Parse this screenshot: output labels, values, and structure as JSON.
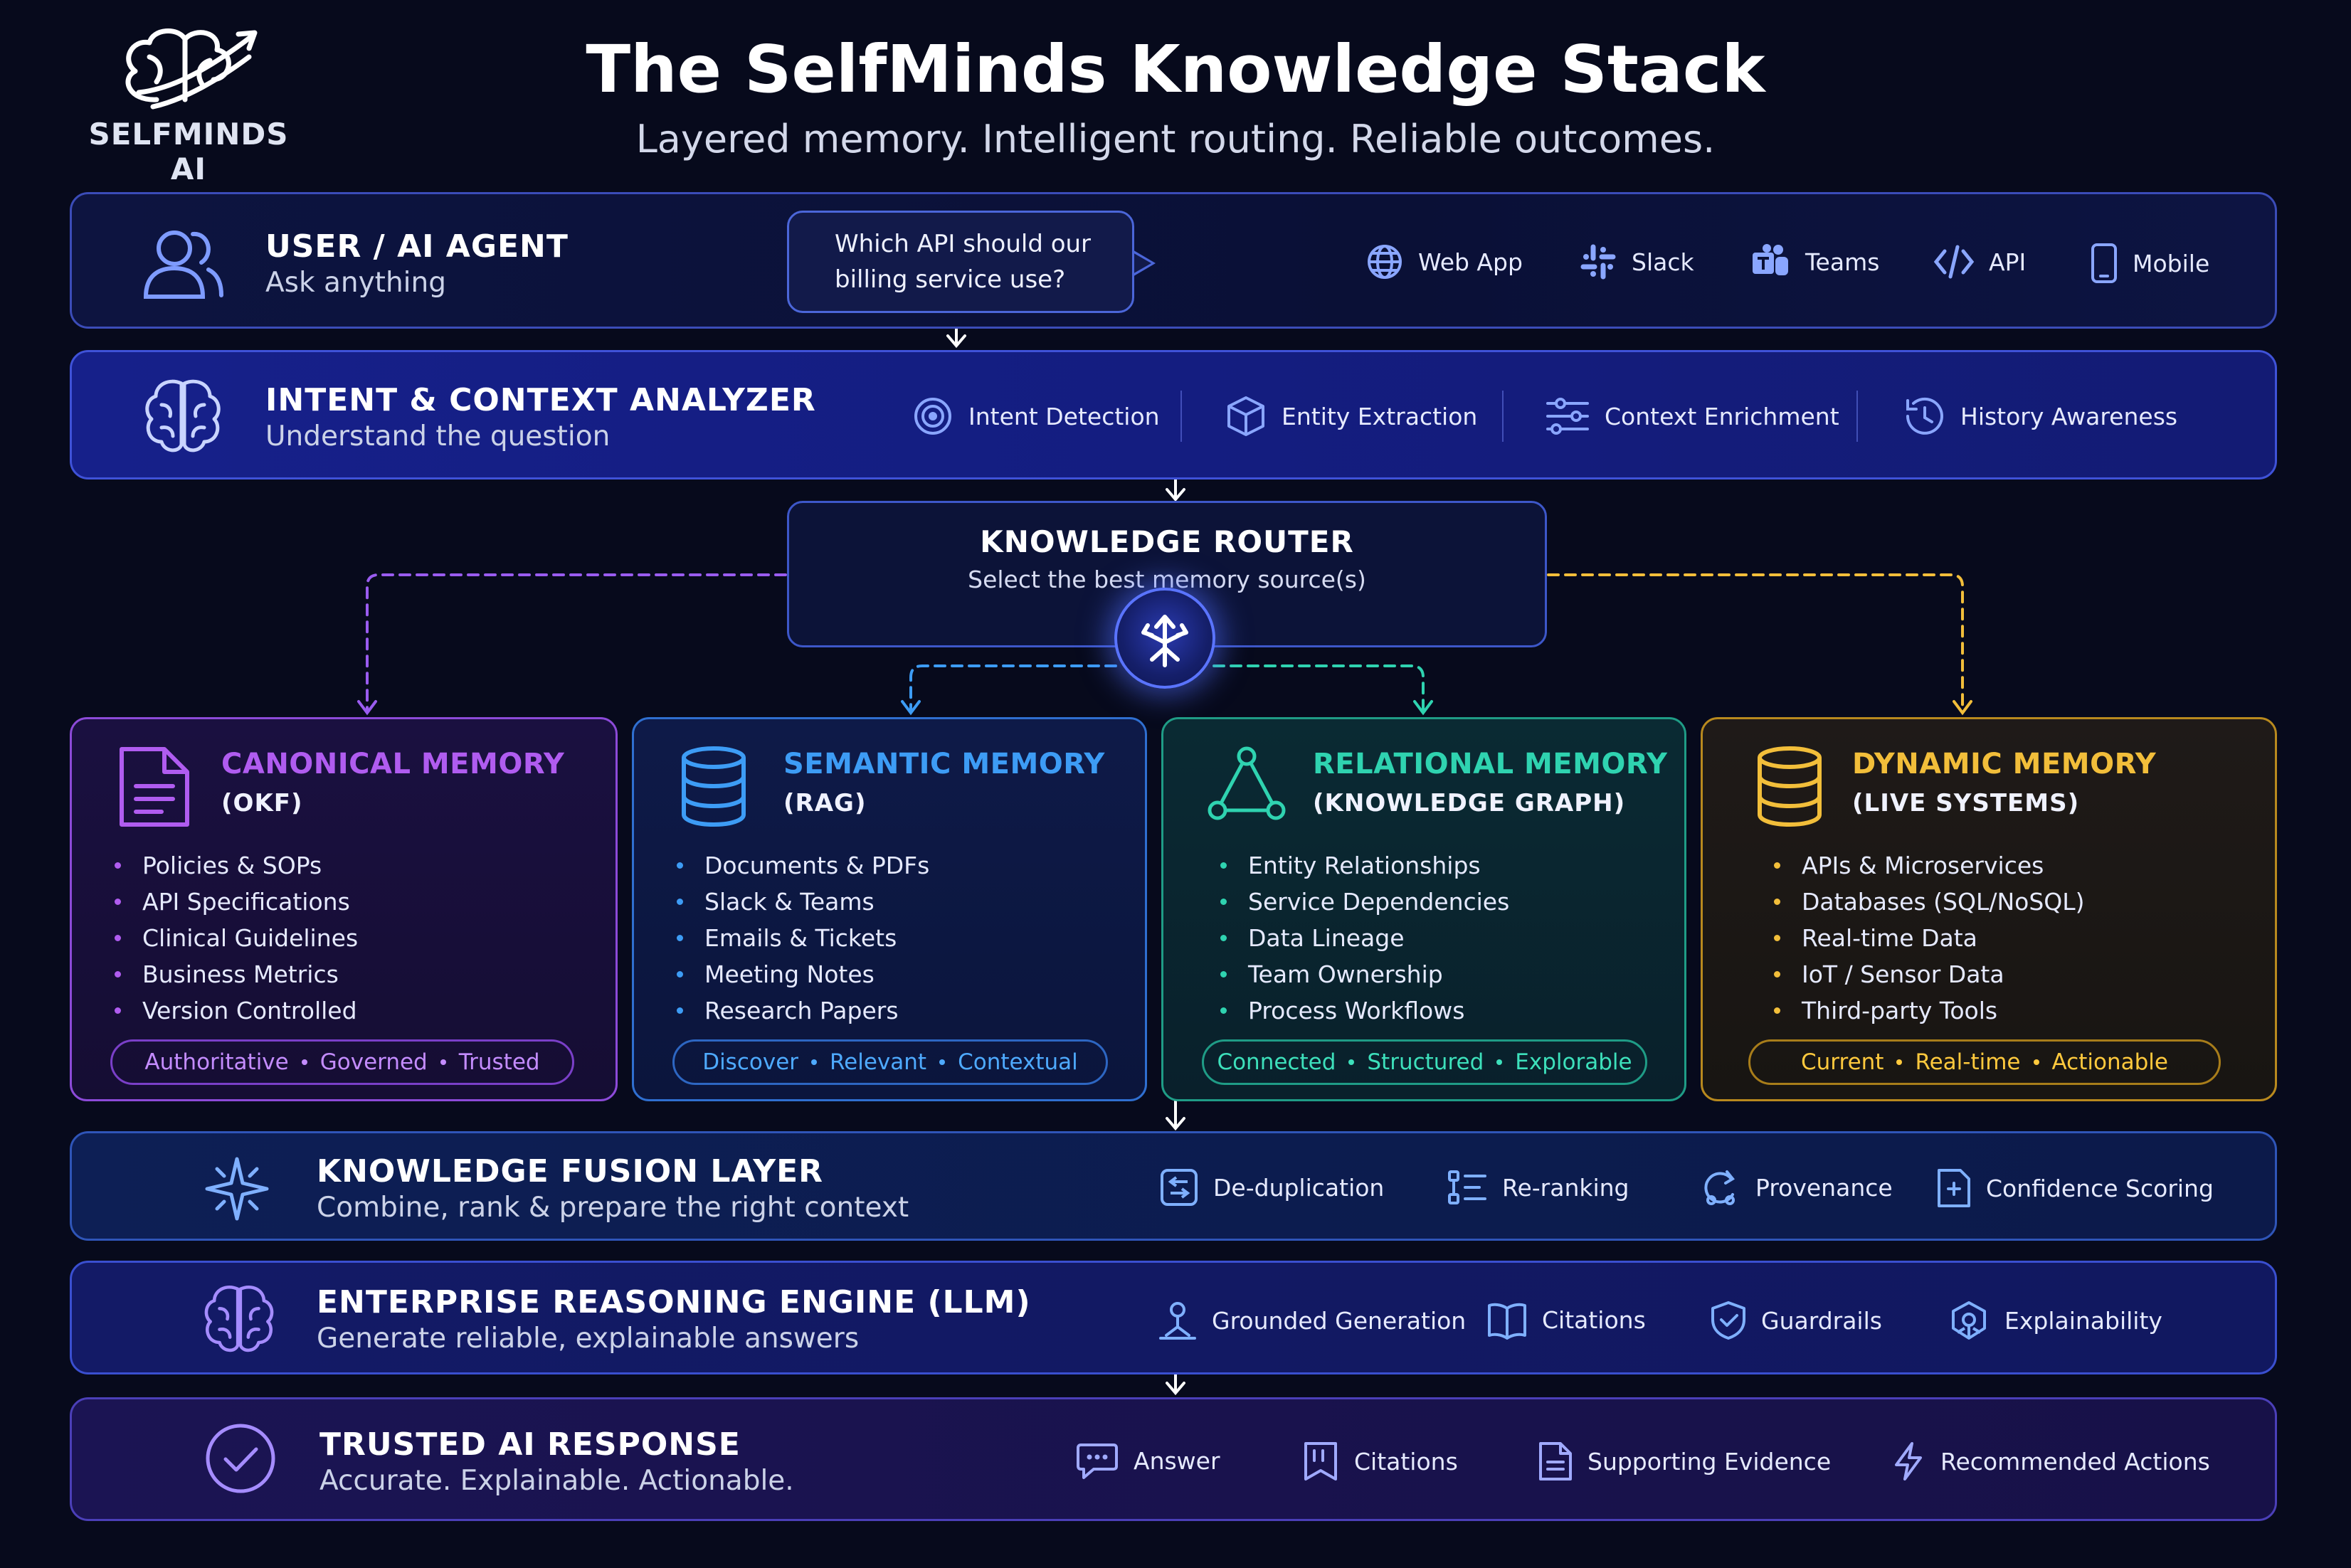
{
  "header": {
    "logo_text": "SELFMINDS AI",
    "title": "The SelfMinds Knowledge Stack",
    "subtitle": "Layered memory. Intelligent routing. Reliable outcomes."
  },
  "user_layer": {
    "title": "USER / AI AGENT",
    "subtitle": "Ask anything",
    "question_line1": "Which API should our",
    "question_line2": "billing service use?",
    "channels": [
      {
        "label": "Web App",
        "icon": "globe-icon"
      },
      {
        "label": "Slack",
        "icon": "slack-icon"
      },
      {
        "label": "Teams",
        "icon": "teams-icon"
      },
      {
        "label": "API",
        "icon": "code-icon"
      },
      {
        "label": "Mobile",
        "icon": "mobile-icon"
      }
    ]
  },
  "intent_layer": {
    "title": "INTENT & CONTEXT ANALYZER",
    "subtitle": "Understand the question",
    "features": [
      {
        "label": "Intent Detection",
        "icon": "target-icon"
      },
      {
        "label": "Entity Extraction",
        "icon": "cube-icon"
      },
      {
        "label": "Context Enrichment",
        "icon": "sliders-icon"
      },
      {
        "label": "History Awareness",
        "icon": "history-icon"
      }
    ]
  },
  "router": {
    "title": "KNOWLEDGE ROUTER",
    "subtitle": "Select the best memory source(s)"
  },
  "memories": [
    {
      "title": "CANONICAL MEMORY",
      "subtitle": "(OKF)",
      "color": "#b05cf0",
      "items": [
        "Policies & SOPs",
        "API Specifications",
        "Clinical Guidelines",
        "Business Metrics",
        "Version Controlled"
      ],
      "tags": [
        "Authoritative",
        "Governed",
        "Trusted"
      ]
    },
    {
      "title": "SEMANTIC MEMORY",
      "subtitle": "(RAG)",
      "color": "#3d9cf5",
      "items": [
        "Documents & PDFs",
        "Slack & Teams",
        "Emails & Tickets",
        "Meeting Notes",
        "Research Papers"
      ],
      "tags": [
        "Discover",
        "Relevant",
        "Contextual"
      ]
    },
    {
      "title": "RELATIONAL MEMORY",
      "subtitle": "(KNOWLEDGE GRAPH)",
      "color": "#2fd3b0",
      "items": [
        "Entity Relationships",
        "Service Dependencies",
        "Data Lineage",
        "Team Ownership",
        "Process Workflows"
      ],
      "tags": [
        "Connected",
        "Structured",
        "Explorable"
      ]
    },
    {
      "title": "DYNAMIC MEMORY",
      "subtitle": "(LIVE SYSTEMS)",
      "color": "#f2be3a",
      "items": [
        "APIs & Microservices",
        "Databases (SQL/NoSQL)",
        "Real-time Data",
        "IoT / Sensor Data",
        "Third-party Tools"
      ],
      "tags": [
        "Current",
        "Real-time",
        "Actionable"
      ]
    }
  ],
  "fusion_layer": {
    "title": "KNOWLEDGE FUSION LAYER",
    "subtitle": "Combine, rank & prepare the right context",
    "features": [
      {
        "label": "De-duplication",
        "icon": "dedupe-icon"
      },
      {
        "label": "Re-ranking",
        "icon": "rerank-icon"
      },
      {
        "label": "Provenance",
        "icon": "provenance-icon"
      },
      {
        "label": "Confidence Scoring",
        "icon": "confidence-icon"
      }
    ]
  },
  "reasoning_layer": {
    "title": "ENTERPRISE REASONING ENGINE (LLM)",
    "subtitle": "Generate reliable, explainable answers",
    "features": [
      {
        "label": "Grounded Generation",
        "icon": "grounded-icon"
      },
      {
        "label": "Citations",
        "icon": "book-icon"
      },
      {
        "label": "Guardrails",
        "icon": "shield-icon"
      },
      {
        "label": "Explainability",
        "icon": "explain-icon"
      }
    ]
  },
  "response_layer": {
    "title": "TRUSTED AI RESPONSE",
    "subtitle": "Accurate. Explainable. Actionable.",
    "features": [
      {
        "label": "Answer",
        "icon": "chat-icon"
      },
      {
        "label": "Citations",
        "icon": "citation-icon"
      },
      {
        "label": "Supporting Evidence",
        "icon": "document-icon"
      },
      {
        "label": "Recommended Actions",
        "icon": "lightning-icon"
      }
    ]
  }
}
